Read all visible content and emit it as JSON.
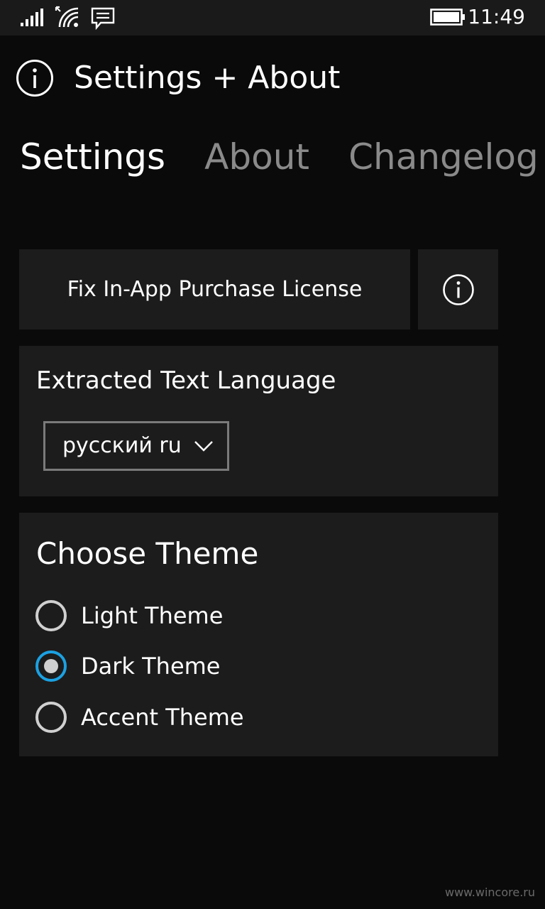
{
  "status_bar": {
    "time": "11:49",
    "icons": [
      "signal-icon",
      "wifi-icon",
      "message-icon",
      "battery-icon"
    ]
  },
  "header": {
    "title": "Settings + About",
    "icon": "info-icon"
  },
  "tabs": [
    {
      "label": "Settings",
      "active": true
    },
    {
      "label": "About",
      "active": false
    },
    {
      "label": "Changelog",
      "active": false
    }
  ],
  "settings": {
    "purchase_button_label": "Fix In-App Purchase License",
    "info_button_icon": "info-icon",
    "language": {
      "heading": "Extracted Text Language",
      "selected_value": "русский ru"
    },
    "theme": {
      "heading": "Choose Theme",
      "options": [
        {
          "label": "Light Theme",
          "selected": false
        },
        {
          "label": "Dark Theme",
          "selected": true
        },
        {
          "label": "Accent Theme",
          "selected": false
        }
      ]
    }
  },
  "watermark": "www.wincore.ru",
  "colors": {
    "background": "#0a0a0a",
    "card": "#1c1c1c",
    "accent": "#1ba1e2",
    "inactive_tab": "#8a8a8a"
  }
}
